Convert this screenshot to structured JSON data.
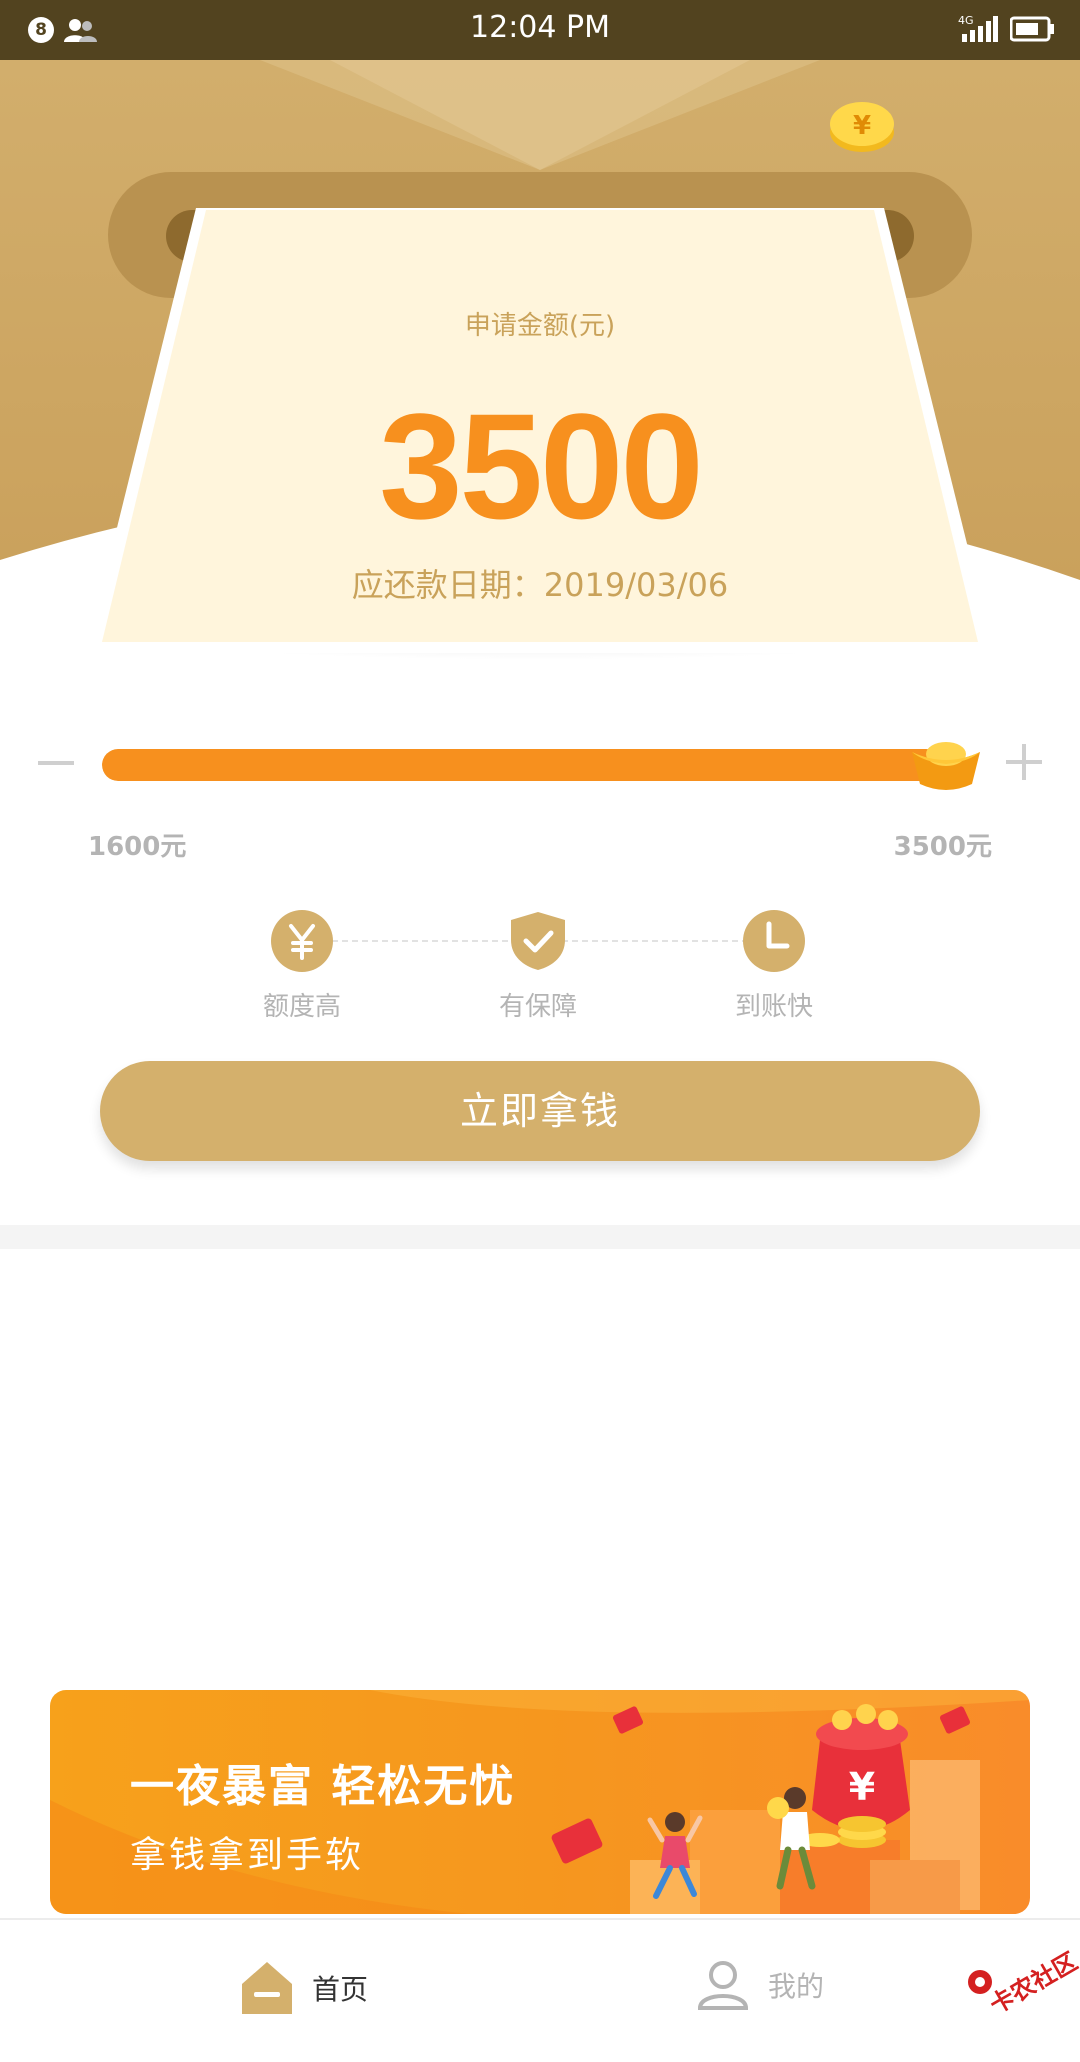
{
  "status_bar": {
    "time": "12:04 PM",
    "notification_count": "8",
    "network": "4G",
    "icons": [
      "notification-badge",
      "people-icon",
      "signal-icon",
      "battery-icon"
    ]
  },
  "card": {
    "apply_label": "申请金额(元)",
    "amount": "3500",
    "due_label": "应还款日期：",
    "due_date": "2019/03/06"
  },
  "slider": {
    "min_label": "1600元",
    "max_label": "3500元",
    "min": 1600,
    "max": 3500,
    "value": 3500
  },
  "features": [
    {
      "label": "额度高",
      "icon": "yen-icon"
    },
    {
      "label": "有保障",
      "icon": "shield-check-icon"
    },
    {
      "label": "到账快",
      "icon": "clock-icon"
    }
  ],
  "cta": {
    "label": "立即拿钱"
  },
  "banner": {
    "title": "一夜暴富  轻松无忧",
    "subtitle": "拿钱拿到手软"
  },
  "nav": {
    "home": "首页",
    "mine": "我的"
  },
  "watermark": "卡农社区",
  "colors": {
    "status_bar": "#52431f",
    "gold": "#d4b06c",
    "orange": "#f7901e",
    "card_bg": "#fff5dc",
    "muted": "#b4b4b4"
  }
}
